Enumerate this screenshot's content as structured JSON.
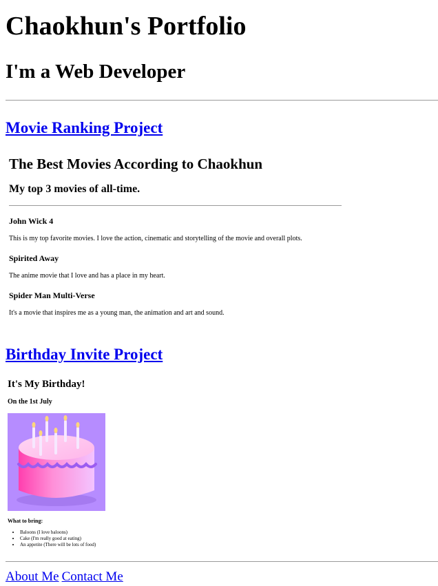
{
  "header": {
    "title": "Chaokhun's Portfolio",
    "subtitle": "I'm a Web Developer"
  },
  "projects": {
    "movie": {
      "link": "Movie Ranking Project",
      "title": "The Best Movies According to Chaokhun",
      "subtitle": "My top 3 movies of all-time.",
      "movies": [
        {
          "name": "John Wick 4",
          "desc": "This is my top favorite movies. I love the action, cinematic and storytelling of the movie and overall plots."
        },
        {
          "name": "Spirited Away",
          "desc": "The anime movie that I love and has a place in my heart."
        },
        {
          "name": "Spider Man Multi-Verse",
          "desc": "It's a movie that inspires me as a young man, the animation and art and sound."
        }
      ]
    },
    "birthday": {
      "link": "Birthday Invite Project",
      "title": "It's My Birthday!",
      "date": "On the 1st July",
      "bring_title": "What to bring:",
      "bring_items": [
        "Baloons (I love baloons)",
        "Cake (I'm really good at eating)",
        "An appetite (There will be lots of food)"
      ]
    }
  },
  "footer": {
    "about": "About Me",
    "contact": "Contact Me"
  },
  "colors": {
    "link": "#0000ee",
    "cake_bg": "#b68cff",
    "cake_body": "#ff7ad1"
  },
  "icons": {
    "cake": "birthday-cake-image"
  }
}
